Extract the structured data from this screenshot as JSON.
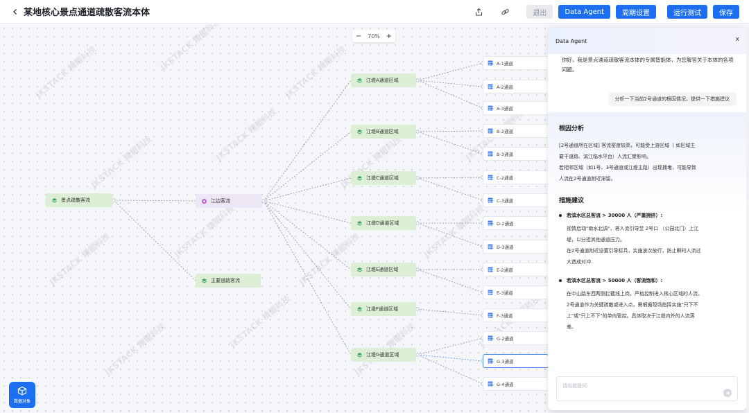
{
  "header": {
    "title": "某地核心景点通道疏散客流本体",
    "exit_label": "退出",
    "data_agent_label": "Data Agent",
    "cycle_label": "周期设置",
    "run_test_label": "运行测试",
    "save_label": "保存"
  },
  "canvas": {
    "zoom": "70%",
    "watermark": "JKSTACK 精鲲科技",
    "root": "景点疏散客流",
    "level1": [
      "江边客流",
      "主要道路客流"
    ],
    "zones": [
      "江堤A通道区域",
      "江堤B通道区域",
      "江堤C通道区域",
      "江堤D通道区域",
      "江堤E通道区域",
      "江堤F通道区域",
      "江堤G通道区域"
    ],
    "leaves": [
      "A-1通道",
      "A-2通道",
      "A-3通道",
      "B-2通道",
      "B-3通道",
      "C-2通道",
      "C-3通道",
      "D-2通道",
      "D-3通道",
      "E-2通道",
      "E-3通道",
      "F-3通道",
      "G-2通道",
      "G-3通道",
      "G-4通道"
    ],
    "data_object_label": "数据对象"
  },
  "agent": {
    "title": "Data Agent",
    "close": "x",
    "greeting": "你好，我是景点通道疏散客流本体的专属智能体，为您解答关于本体的各项问题。",
    "user_question": "分析一下当前2号通道的根因情况，提供一下措施建议",
    "root_cause_heading": "根因分析",
    "root_cause_lines": [
      "[2号通道所在区域] 客流密度较高，可能受上游区域（ 如区域主",
      "要干道路、滨江临水平台）人流汇聚影响。",
      "若相邻区域（如1号、3号通道或江堤主路）出现拥堵，可能导致",
      "人流在2号通道附近滞留。"
    ],
    "measures_heading": "措施建议",
    "measure1_title": "若滨水区总客流 > 30000 人（严重拥挤）:",
    "measure1_lines": [
      "视情启动\"南水北调\"，将人流引导至 2号口 （公园北门）上江",
      "堤，以分担其他通道压力。",
      "在2号通道附近设置引导标兵，实施波次放行，防止瞬时人流过",
      "大造成对冲"
    ],
    "measure2_title": "若滨水区总客流 > 50000 人（客流饱和）:",
    "measure2_lines": [
      "在中山路东西两侧拦截线上岗，严格控制进入核心区域的人流。",
      "2号通道作为关键疏散或进入点，需根据现场指挥实施\"只下不",
      "上\"或\"只上不下\"的单向管控。具体取决于江堤内外的人流落",
      "差。"
    ],
    "input_placeholder": "请向我提问"
  },
  "colors": {
    "accent": "#1d6ff2",
    "node_green": "#dcefd6",
    "node_purple": "#ece6f5"
  }
}
